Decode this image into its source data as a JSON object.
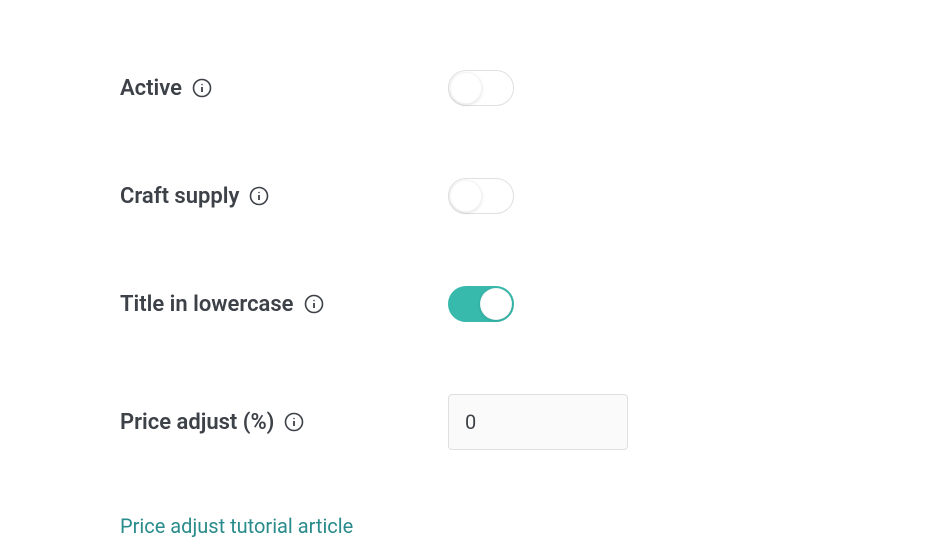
{
  "rows": {
    "active": {
      "label": "Active",
      "value": false
    },
    "craft_supply": {
      "label": "Craft supply",
      "value": false
    },
    "title_lowercase": {
      "label": "Title in lowercase",
      "value": true
    },
    "price_adjust": {
      "label": "Price adjust (%)",
      "value": "0"
    }
  },
  "link": {
    "label": "Price adjust tutorial article"
  }
}
